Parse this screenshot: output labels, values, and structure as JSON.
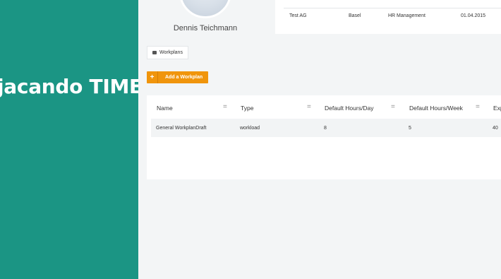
{
  "brand": {
    "title": "jacando TIME"
  },
  "profile": {
    "name": "Dennis Teichmann"
  },
  "employment": {
    "company": "Test AG",
    "location": "Basel",
    "department": "HR Management",
    "start_date": "01.04.2015"
  },
  "tabs": {
    "workplans": "Workplans"
  },
  "actions": {
    "add_workplan_plus": "+",
    "add_workplan": "Add a Workplan"
  },
  "table": {
    "headers": [
      "Name",
      "Type",
      "Default Hours/Day",
      "Default Hours/Week",
      "Exp"
    ],
    "sort_glyph": "=",
    "rows": [
      {
        "name": "General WorkplanDraft",
        "type": "workload",
        "hours_day": "8",
        "hours_week": "5",
        "exp": "40"
      }
    ]
  },
  "colors": {
    "brand": "#1b9584",
    "accent": "#f0950c",
    "background": "#f3f5f6"
  }
}
